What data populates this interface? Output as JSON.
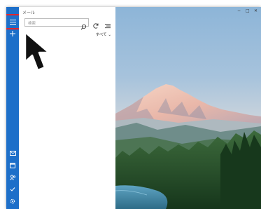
{
  "app": {
    "title": "メール"
  },
  "search": {
    "placeholder": "検索"
  },
  "filter": {
    "label": "すべて"
  },
  "window_controls": {
    "minimize": "−",
    "maximize": "□",
    "close": "✕"
  },
  "rail": {
    "items": [
      "menu-icon",
      "compose-icon",
      "mail-icon",
      "calendar-icon",
      "people-icon",
      "todo-icon",
      "settings-icon"
    ]
  },
  "colors": {
    "rail": "#1d6fc9",
    "highlight": "#e2252b"
  }
}
